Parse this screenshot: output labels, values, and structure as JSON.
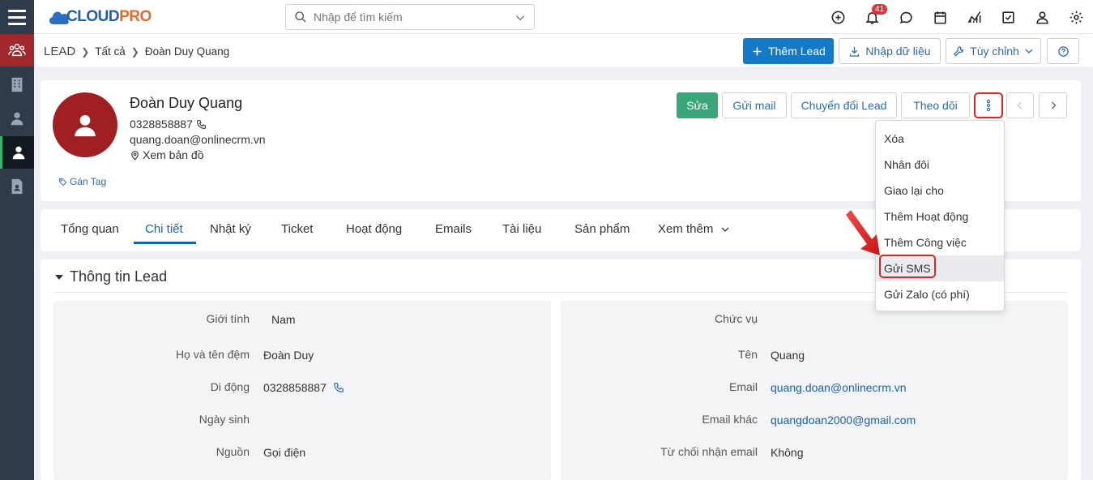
{
  "header": {
    "logo_text_a": "CLOUD",
    "logo_text_b": "PRO",
    "search_placeholder": "Nhập để tìm kiếm",
    "notification_count": "41"
  },
  "breadcrumb": {
    "module": "LEAD",
    "level1": "Tất cả",
    "level2": "Đoàn Duy Quang"
  },
  "actions": {
    "add_lead": "Thêm Lead",
    "import": "Nhập dữ liệu",
    "customize": "Tùy chỉnh"
  },
  "profile": {
    "name": "Đoàn Duy Quang",
    "phone": "0328858887",
    "email": "quang.doan@onlinecrm.vn",
    "map": "Xem bản đồ",
    "tag": "Gán Tag"
  },
  "profile_buttons": {
    "edit": "Sửa",
    "send_mail": "Gửi mail",
    "convert": "Chuyển đổi Lead",
    "follow": "Theo dõi"
  },
  "tabs": [
    "Tổng quan",
    "Chi tiết",
    "Nhật ký",
    "Ticket",
    "Hoạt động",
    "Emails",
    "Tài liệu",
    "Sản phẩm",
    "Xem thêm"
  ],
  "section": {
    "title": "Thông tin Lead"
  },
  "fields_left": [
    {
      "label": "Giới tính",
      "value": "Nam"
    },
    {
      "label": "Họ và tên đệm",
      "value": "Đoàn Duy"
    },
    {
      "label": "Di động",
      "value": "0328858887"
    },
    {
      "label": "Ngày sinh",
      "value": ""
    },
    {
      "label": "Nguồn",
      "value": "Gọi điện"
    }
  ],
  "fields_right": [
    {
      "label": "Chức vụ",
      "value": ""
    },
    {
      "label": "Tên",
      "value": "Quang"
    },
    {
      "label": "Email",
      "value": "quang.doan@onlinecrm.vn"
    },
    {
      "label": "Email khác",
      "value": "quangdoan2000@gmail.com"
    },
    {
      "label": "Từ chối nhận email",
      "value": "Không"
    }
  ],
  "more_menu": [
    "Xóa",
    "Nhân đôi",
    "Giao lại cho",
    "Thêm Hoạt động",
    "Thêm Công việc",
    "Gửi SMS",
    "Gửi Zalo (có phí)"
  ],
  "colors": {
    "primary": "#1479c6",
    "success": "#3aa67a",
    "highlight": "#e02424",
    "avatar": "#a01f22",
    "sidebar": "#2f3b4b"
  }
}
